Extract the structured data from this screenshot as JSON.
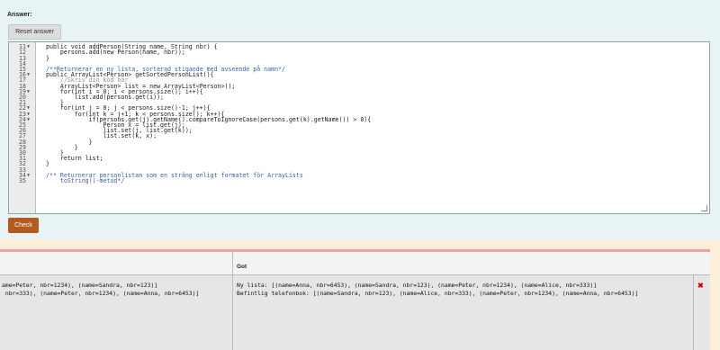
{
  "answer": {
    "label": "Answer:",
    "reset_label": "Reset answer"
  },
  "editor": {
    "lines": [
      {
        "num": "11",
        "fold": "▼",
        "text": "public void addPerson(String name, String nbr) {",
        "color": "#1a1a1a"
      },
      {
        "num": "12",
        "fold": "",
        "text": "    persons.add(new Person(name, nbr));",
        "color": "#1a1a1a"
      },
      {
        "num": "13",
        "fold": "",
        "text": "}",
        "color": "#1a1a1a"
      },
      {
        "num": "14",
        "fold": "",
        "text": "",
        "color": "#1a1a1a"
      },
      {
        "num": "15",
        "fold": "",
        "text": "/**Returnerar en ny lista, sorterad stigande med avseende på namn*/",
        "color": "#3b5ea8"
      },
      {
        "num": "16",
        "fold": "▼",
        "text": "public ArrayList<Person> getSortedPersonList(){",
        "color": "#1a1a1a"
      },
      {
        "num": "17",
        "fold": "",
        "text": "    //Skriv din kod här",
        "color": "#8a8fb5"
      },
      {
        "num": "18",
        "fold": "",
        "text": "    ArrayList<Person> list = new ArrayList<Person>();",
        "color": "#1a1a1a"
      },
      {
        "num": "19",
        "fold": "▼",
        "text": "    for(int i = 0; i < persons.size(); i++){",
        "color": "#1a1a1a"
      },
      {
        "num": "20",
        "fold": "",
        "text": "        list.add(persons.get(i));",
        "color": "#1a1a1a"
      },
      {
        "num": "21",
        "fold": "",
        "text": "    }",
        "color": "#1a1a1a"
      },
      {
        "num": "22",
        "fold": "▼",
        "text": "    for(int j = 0; j < persons.size()-1; j++){",
        "color": "#1a1a1a"
      },
      {
        "num": "23",
        "fold": "▼",
        "text": "        for(int k = j+1; k < persons.size(); k++){",
        "color": "#1a1a1a"
      },
      {
        "num": "24",
        "fold": "▼",
        "text": "            if(persons.get(j).getName().compareToIgnoreCase(persons.get(k).getName()) > 0){",
        "color": "#1a1a1a"
      },
      {
        "num": "25",
        "fold": "",
        "text": "                Person x = list.get(j);",
        "color": "#1a1a1a"
      },
      {
        "num": "26",
        "fold": "",
        "text": "                list.set(j, list.get(k));",
        "color": "#1a1a1a"
      },
      {
        "num": "27",
        "fold": "",
        "text": "                list.set(k, x);",
        "color": "#1a1a1a"
      },
      {
        "num": "28",
        "fold": "",
        "text": "            }",
        "color": "#1a1a1a"
      },
      {
        "num": "29",
        "fold": "",
        "text": "        }",
        "color": "#1a1a1a"
      },
      {
        "num": "30",
        "fold": "",
        "text": "    }",
        "color": "#1a1a1a"
      },
      {
        "num": "31",
        "fold": "",
        "text": "    return list;",
        "color": "#1a1a1a"
      },
      {
        "num": "32",
        "fold": "",
        "text": "}",
        "color": "#1a1a1a"
      },
      {
        "num": "33",
        "fold": "",
        "text": "",
        "color": "#1a1a1a"
      },
      {
        "num": "34",
        "fold": "▼",
        "text": "/** Returnerar personlistan som en sträng enligt formatet för ArrayLists",
        "color": "#3b5ea8"
      },
      {
        "num": "35",
        "fold": "",
        "text": "    toString()-metod*/",
        "color": "#3b5ea8"
      }
    ]
  },
  "check_label": "Check",
  "results": {
    "got_header": "Got",
    "expected_lines": [
      "ame=Peter, nbr=1234), (name=Sandra, nbr=123)]",
      " nbr=333), (name=Peter, nbr=1234), (name=Anna, nbr=6453)]"
    ],
    "got_lines": [
      "Ny lista: [(name=Anna, nbr=6453), (name=Sandra, nbr=123), (name=Peter, nbr=1234), (name=Alice, nbr=333)]",
      "Befintlig telefonbok: [(name=Sandra, nbr=123), (name=Alice, nbr=333), (name=Peter, nbr=1234), (name=Anna, nbr=6453)]"
    ],
    "status_icon": "cross-icon"
  }
}
